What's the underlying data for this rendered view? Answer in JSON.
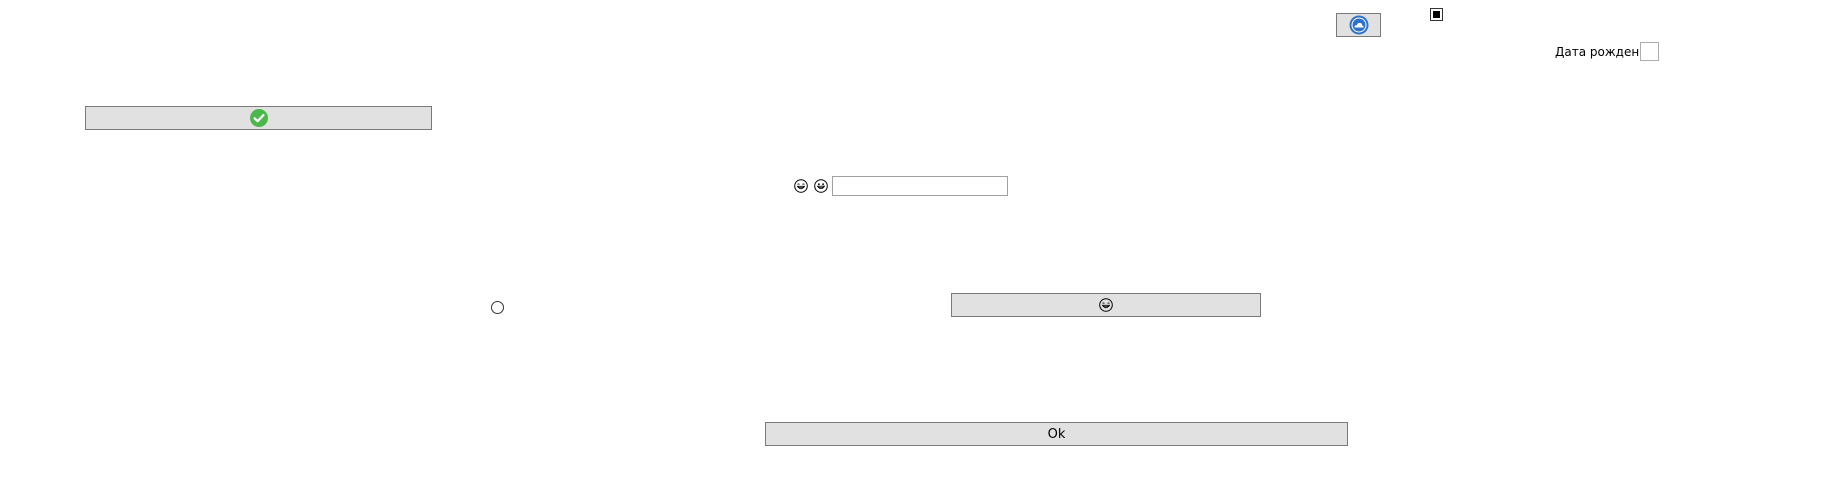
{
  "top_icon_button": {
    "icon": "cloud-circle-icon"
  },
  "top_checkbox": {
    "state": "indeterminate"
  },
  "dob": {
    "label": "Дата рождения"
  },
  "check_button": {
    "icon": "green-check-circle-icon",
    "color": "#4cb84c"
  },
  "emoji_pair": {
    "icons": [
      "grinning-face-icon",
      "smiling-face-icon"
    ]
  },
  "text_input": {
    "value": "",
    "placeholder": ""
  },
  "radio": {
    "checked": false
  },
  "emoji_button": {
    "icon": "grinning-face-icon"
  },
  "ok_button": {
    "label": "Ok"
  }
}
